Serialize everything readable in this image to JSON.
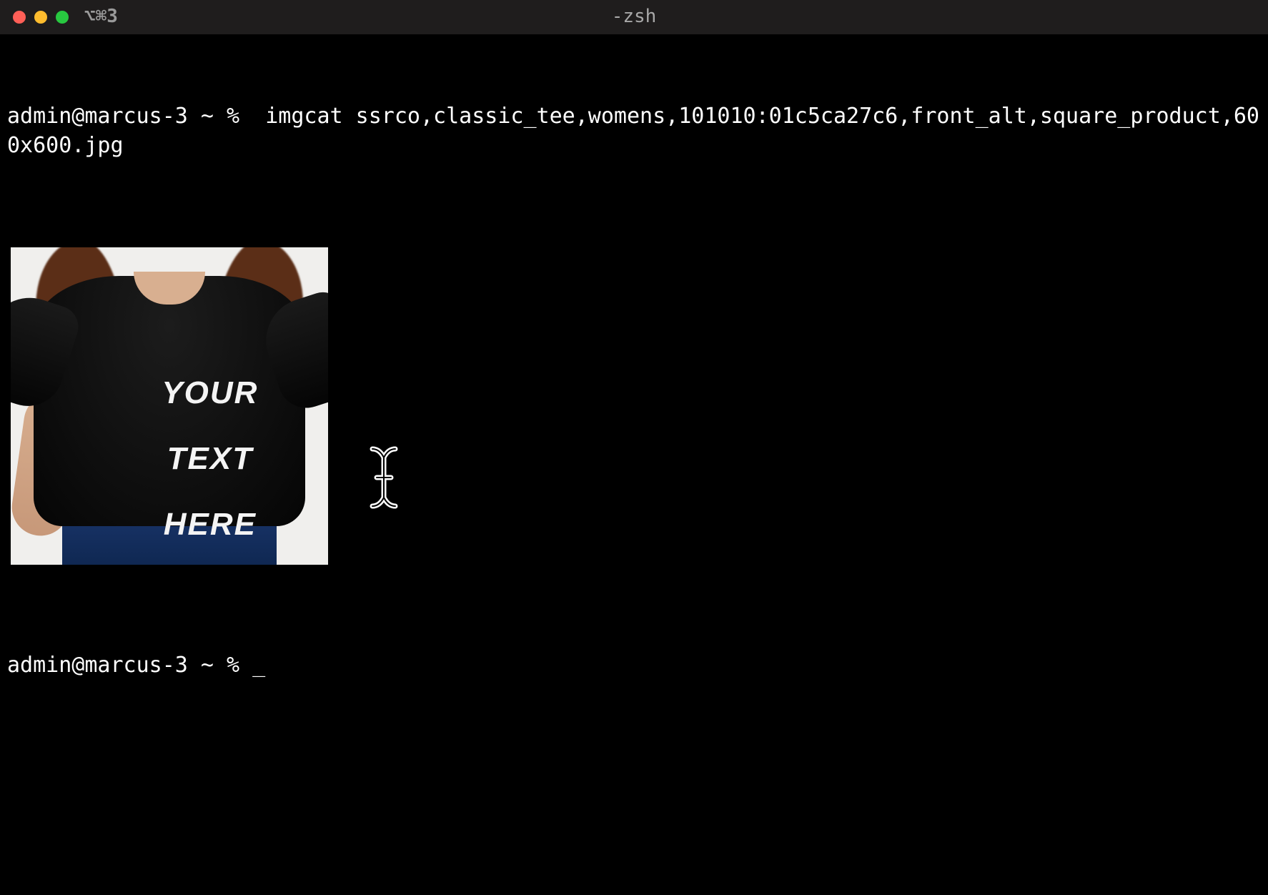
{
  "titlebar": {
    "shortcut_hint": "⌥⌘3",
    "process_title": "-zsh",
    "buttons": {
      "close": "close",
      "minimize": "minimize",
      "zoom": "zoom"
    }
  },
  "terminal": {
    "prompt1": "admin@marcus-3 ~ % ",
    "command": " imgcat ssrco,classic_tee,womens,101010:01c5ca27c6,front_alt,square_product,600x600.jpg",
    "tee_line1": "YOUR",
    "tee_line2": "TEXT",
    "tee_line3": "HERE",
    "prompt2": "admin@marcus-3 ~ % "
  },
  "icons": {
    "text_cursor": "i-beam-cursor-icon"
  }
}
